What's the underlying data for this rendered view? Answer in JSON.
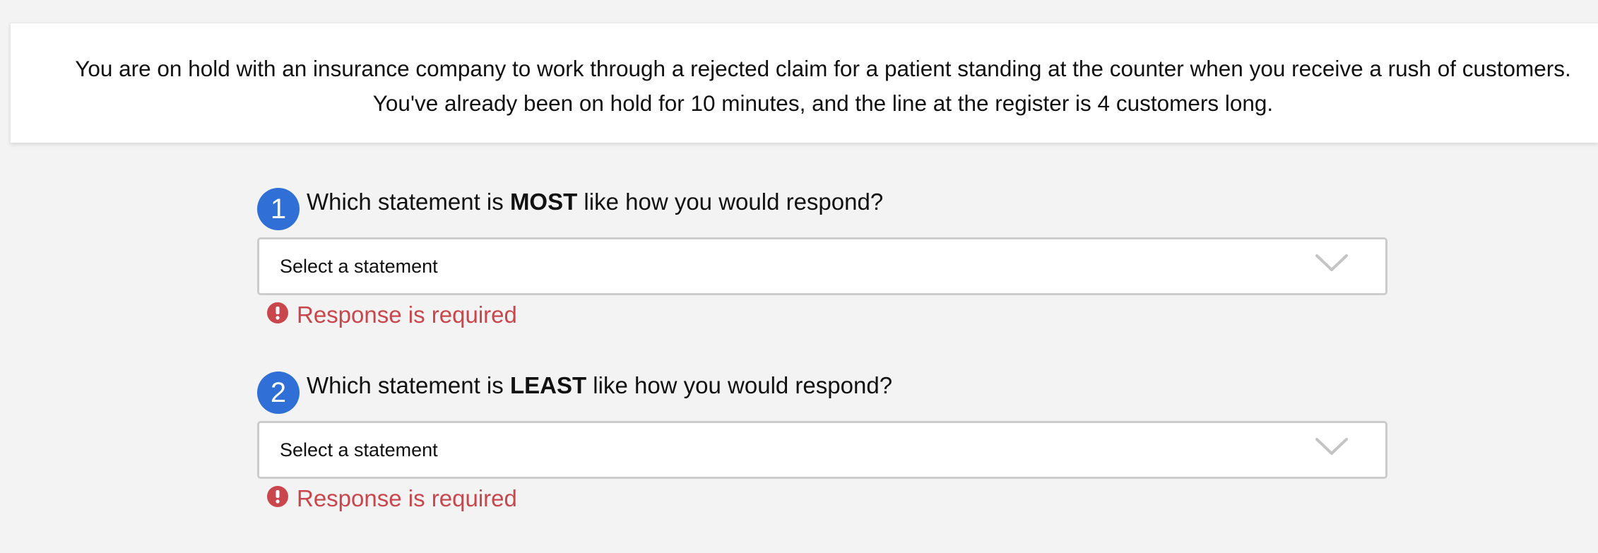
{
  "scenario": {
    "line1": "You are on hold with an insurance company to work through a rejected claim for a patient standing at the counter when you receive a rush of customers.",
    "line2": "You've already been on hold for 10 minutes, and the line at the register is 4 customers long."
  },
  "questions": [
    {
      "number": "1",
      "prompt_before": "Which statement is ",
      "prompt_emphasis": "MOST",
      "prompt_after": " like how you would respond?",
      "select_value": "Select a statement",
      "error": "Response is required",
      "icons": {
        "dropdown": "chevron-down-icon",
        "error": "exclamation-circle-icon"
      }
    },
    {
      "number": "2",
      "prompt_before": "Which statement is ",
      "prompt_emphasis": "LEAST",
      "prompt_after": " like how you would respond?",
      "select_value": "Select a statement",
      "error": "Response is required",
      "icons": {
        "dropdown": "chevron-down-icon",
        "error": "exclamation-circle-icon"
      }
    }
  ],
  "colors": {
    "accent": "#2f6fd6",
    "error": "#c9474c",
    "background": "#f3f3f3",
    "card": "#ffffff"
  }
}
